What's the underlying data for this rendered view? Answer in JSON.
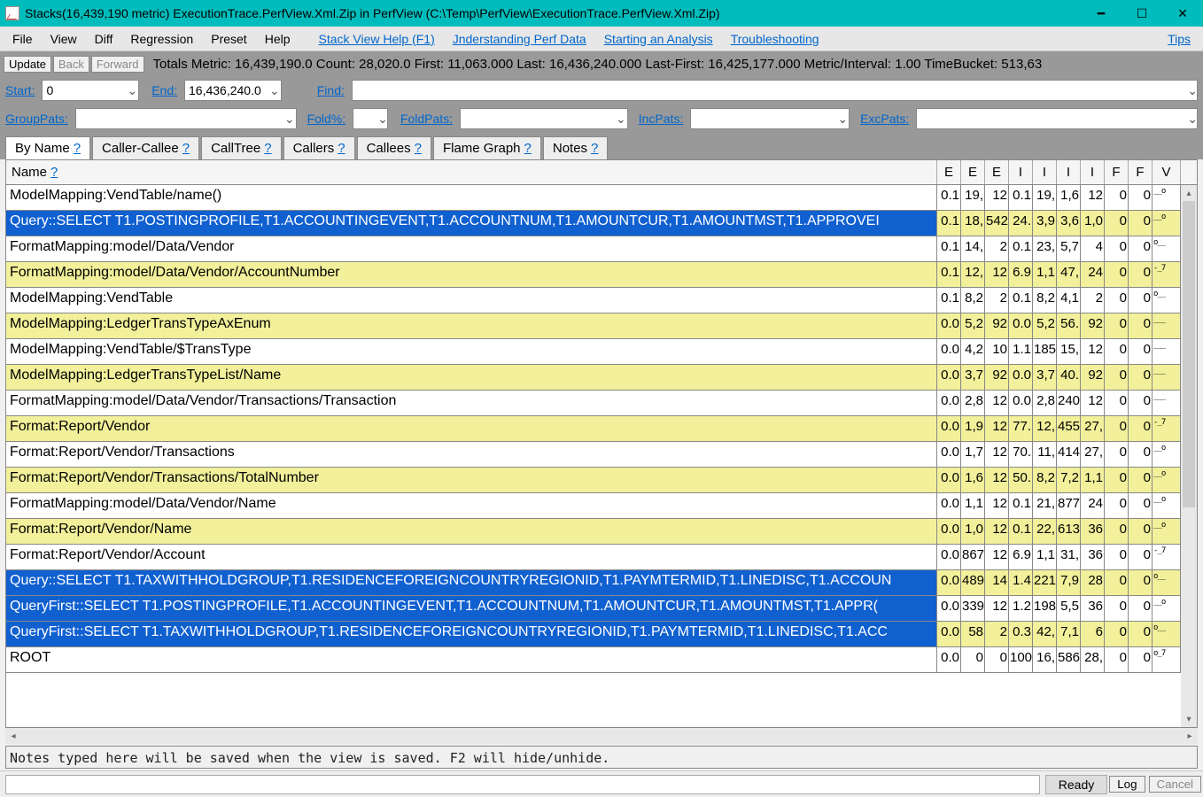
{
  "window": {
    "title": "Stacks(16,439,190 metric) ExecutionTrace.PerfView.Xml.Zip in PerfView (C:\\Temp\\PerfView\\ExecutionTrace.PerfView.Xml.Zip)"
  },
  "menu": {
    "items": [
      "File",
      "View",
      "Diff",
      "Regression",
      "Preset",
      "Help"
    ],
    "links": [
      "Stack View Help (F1)",
      "Jnderstanding Perf Data",
      "Starting an Analysis",
      "Troubleshooting",
      "Tips"
    ]
  },
  "toolbar": {
    "update": "Update",
    "back": "Back",
    "forward": "Forward",
    "totals": "Totals Metric: 16,439,190.0   Count: 28,020.0   First: 11,063.000  Last: 16,436,240.000   Last-First: 16,425,177.000   Metric/Interval: 1.00   TimeBucket: 513,63"
  },
  "params": {
    "start_label": "Start:",
    "start_value": "0",
    "end_label": "End:",
    "end_value": "16,436,240.0",
    "find_label": "Find:",
    "find_value": "",
    "grouppats_label": "GroupPats:",
    "grouppats_value": "",
    "foldpct_label": "Fold%:",
    "foldpct_value": "",
    "foldpats_label": "FoldPats:",
    "foldpats_value": "",
    "incpats_label": "IncPats:",
    "incpats_value": "",
    "excpats_label": "ExcPats:",
    "excpats_value": ""
  },
  "tabs": [
    {
      "label": "By Name",
      "q": "?",
      "active": true
    },
    {
      "label": "Caller-Callee",
      "q": "?"
    },
    {
      "label": "CallTree",
      "q": "?"
    },
    {
      "label": "Callers",
      "q": "?"
    },
    {
      "label": "Callees",
      "q": "?"
    },
    {
      "label": "Flame Graph",
      "q": "?"
    },
    {
      "label": "Notes",
      "q": "?"
    }
  ],
  "columns": {
    "name": "Name",
    "q": "?",
    "heads": [
      "E",
      "E",
      "E",
      "I",
      "I",
      "I",
      "I",
      "F",
      "F",
      "V"
    ]
  },
  "rows": [
    {
      "n": "ModelMapping:VendTable/name()",
      "c": [
        "0.1",
        "19,",
        "12",
        "0.1",
        "19,",
        "1,6",
        "12",
        "0",
        "0"
      ],
      "v": "__o"
    },
    {
      "n": "Query::SELECT T1.POSTINGPROFILE,T1.ACCOUNTINGEVENT,T1.ACCOUNTNUM,T1.AMOUNTCUR,T1.AMOUNTMST,T1.APPROVEI",
      "c": [
        "0.1",
        "18,",
        "542",
        "24.",
        "3,9",
        "3,6",
        "1,0",
        "0",
        "0"
      ],
      "v": "__o",
      "sel": true,
      "alt": true
    },
    {
      "n": "FormatMapping:model/Data/Vendor",
      "c": [
        "0.1",
        "14,",
        "2",
        "0.1",
        "23,",
        "5,7",
        "4",
        "0",
        "0"
      ],
      "v": "o__"
    },
    {
      "n": "FormatMapping:model/Data/Vendor/AccountNumber",
      "c": [
        "0.1",
        "12,",
        "12",
        "6.9",
        "1,1",
        "47,",
        "24",
        "0",
        "0"
      ],
      "v": "-_7",
      "alt": true
    },
    {
      "n": "ModelMapping:VendTable",
      "c": [
        "0.1",
        "8,2",
        "2",
        "0.1",
        "8,2",
        "4,1",
        "2",
        "0",
        "0"
      ],
      "v": "o__"
    },
    {
      "n": "ModelMapping:LedgerTransTypeAxEnum",
      "c": [
        "0.0",
        "5,2",
        "92",
        "0.0",
        "5,2",
        "56.",
        "92",
        "0",
        "0"
      ],
      "v": "___",
      "alt": true
    },
    {
      "n": "ModelMapping:VendTable/$TransType",
      "c": [
        "0.0",
        "4,2",
        "10",
        "1.1",
        "185",
        "15,",
        "12",
        "0",
        "0"
      ],
      "v": "___"
    },
    {
      "n": "ModelMapping:LedgerTransTypeList/Name",
      "c": [
        "0.0",
        "3,7",
        "92",
        "0.0",
        "3,7",
        "40.",
        "92",
        "0",
        "0"
      ],
      "v": "___",
      "alt": true
    },
    {
      "n": "FormatMapping:model/Data/Vendor/Transactions/Transaction",
      "c": [
        "0.0",
        "2,8",
        "12",
        "0.0",
        "2,8",
        "240",
        "12",
        "0",
        "0"
      ],
      "v": "___"
    },
    {
      "n": "Format:Report/Vendor",
      "c": [
        "0.0",
        "1,9",
        "12",
        "77.",
        "12,",
        "455",
        "27,",
        "0",
        "0"
      ],
      "v": "-_7",
      "alt": true
    },
    {
      "n": "Format:Report/Vendor/Transactions",
      "c": [
        "0.0",
        "1,7",
        "12",
        "70.",
        "11,",
        "414",
        "27,",
        "0",
        "0"
      ],
      "v": "__o"
    },
    {
      "n": "Format:Report/Vendor/Transactions/TotalNumber",
      "c": [
        "0.0",
        "1,6",
        "12",
        "50.",
        "8,2",
        "7,2",
        "1,1",
        "0",
        "0"
      ],
      "v": "__o",
      "alt": true
    },
    {
      "n": "FormatMapping:model/Data/Vendor/Name",
      "c": [
        "0.0",
        "1,1",
        "12",
        "0.1",
        "21,",
        "877",
        "24",
        "0",
        "0"
      ],
      "v": "__o"
    },
    {
      "n": "Format:Report/Vendor/Name",
      "c": [
        "0.0",
        "1,0",
        "12",
        "0.1",
        "22,",
        "613",
        "36",
        "0",
        "0"
      ],
      "v": "__o",
      "alt": true
    },
    {
      "n": "Format:Report/Vendor/Account",
      "c": [
        "0.0",
        "867",
        "12",
        "6.9",
        "1,1",
        "31,",
        "36",
        "0",
        "0"
      ],
      "v": "-_7"
    },
    {
      "n": "Query::SELECT T1.TAXWITHHOLDGROUP,T1.RESIDENCEFOREIGNCOUNTRYREGIONID,T1.PAYMTERMID,T1.LINEDISC,T1.ACCOUN",
      "c": [
        "0.0",
        "489",
        "14",
        "1.4",
        "221",
        "7,9",
        "28",
        "0",
        "0"
      ],
      "v": "o__",
      "sel": true,
      "alt": true
    },
    {
      "n": "QueryFirst::SELECT T1.POSTINGPROFILE,T1.ACCOUNTINGEVENT,T1.ACCOUNTNUM,T1.AMOUNTCUR,T1.AMOUNTMST,T1.APPR(",
      "c": [
        "0.0",
        "339",
        "12",
        "1.2",
        "198",
        "5,5",
        "36",
        "0",
        "0"
      ],
      "v": "__o",
      "sel": true
    },
    {
      "n": "QueryFirst::SELECT T1.TAXWITHHOLDGROUP,T1.RESIDENCEFOREIGNCOUNTRYREGIONID,T1.PAYMTERMID,T1.LINEDISC,T1.ACC",
      "c": [
        "0.0",
        "58",
        "2",
        "0.3",
        "42,",
        "7,1",
        "6",
        "0",
        "0"
      ],
      "v": "o__",
      "sel": true,
      "alt": true
    },
    {
      "n": "ROOT",
      "c": [
        "0.0",
        "0",
        "0",
        "100",
        "16,",
        "586",
        "28,",
        "0",
        "0"
      ],
      "v": "o_7"
    }
  ],
  "notes": {
    "placeholder": "Notes typed here will be saved when the view is saved. F2 will hide/unhide."
  },
  "status": {
    "ready": "Ready",
    "log": "Log",
    "cancel": "Cancel"
  }
}
